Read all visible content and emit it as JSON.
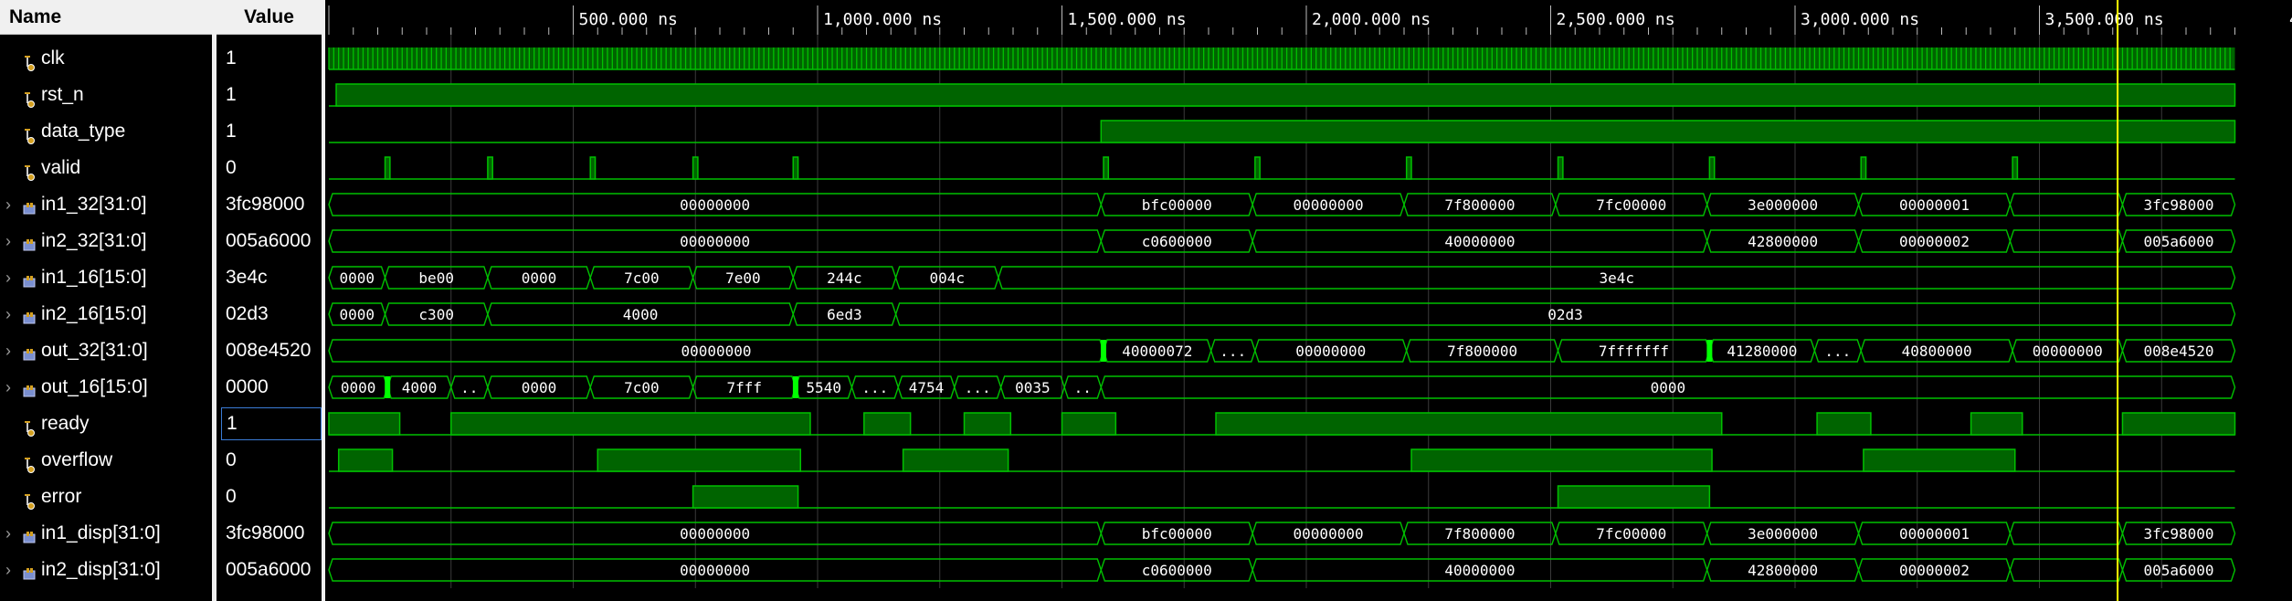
{
  "headers": {
    "name": "Name",
    "value": "Value"
  },
  "colors": {
    "wave": "#00c000",
    "fill": "#006400",
    "cursor": "#ffff00",
    "grid": "#3a3a3a"
  },
  "time_axis": {
    "unit": "ns",
    "range_ns": [
      0,
      3900
    ],
    "labels": [
      {
        "t": 500,
        "text": "500.000 ns"
      },
      {
        "t": 1000,
        "text": "1,000.000 ns"
      },
      {
        "t": 1500,
        "text": "1,500.000 ns"
      },
      {
        "t": 2000,
        "text": "2,000.000 ns"
      },
      {
        "t": 2500,
        "text": "2,500.000 ns"
      },
      {
        "t": 3000,
        "text": "3,000.000 ns"
      },
      {
        "t": 3500,
        "text": "3,500.000 ns"
      },
      {
        "t": 4000,
        "text": "4"
      }
    ]
  },
  "cursor_ns": 3660,
  "signals": [
    {
      "name": "clk",
      "value": "1",
      "kind": "clock",
      "expander": false,
      "icon": "wire-icon"
    },
    {
      "name": "rst_n",
      "value": "1",
      "kind": "bit",
      "expander": false,
      "icon": "wire-icon",
      "high": [
        [
          15,
          3900
        ]
      ]
    },
    {
      "name": "data_type",
      "value": "1",
      "kind": "bit",
      "expander": false,
      "icon": "wire-icon",
      "high": [
        [
          1580,
          3900
        ]
      ]
    },
    {
      "name": "valid",
      "value": "0",
      "kind": "bit",
      "expander": false,
      "icon": "wire-icon",
      "high": [
        [
          115,
          125
        ],
        [
          325,
          335
        ],
        [
          535,
          545
        ],
        [
          745,
          755
        ],
        [
          950,
          960
        ],
        [
          1585,
          1595
        ],
        [
          1895,
          1905
        ],
        [
          2205,
          2215
        ],
        [
          2515,
          2525
        ],
        [
          2825,
          2835
        ],
        [
          3135,
          3145
        ],
        [
          3445,
          3455
        ]
      ]
    },
    {
      "name": "in1_32[31:0]",
      "value": "3fc98000",
      "kind": "bus",
      "expander": true,
      "icon": "bus-icon",
      "segments": [
        [
          0,
          1580,
          "00000000"
        ],
        [
          1580,
          1890,
          "bfc00000"
        ],
        [
          1890,
          2200,
          "00000000"
        ],
        [
          2200,
          2510,
          "7f800000"
        ],
        [
          2510,
          2820,
          "7fc00000"
        ],
        [
          2820,
          3130,
          "3e000000"
        ],
        [
          3130,
          3440,
          "00000001"
        ],
        [
          3440,
          3670,
          ""
        ],
        [
          3670,
          3900,
          "3fc98000"
        ]
      ]
    },
    {
      "name": "in2_32[31:0]",
      "value": "005a6000",
      "kind": "bus",
      "expander": true,
      "icon": "bus-icon",
      "segments": [
        [
          0,
          1580,
          "00000000"
        ],
        [
          1580,
          1890,
          "c0600000"
        ],
        [
          1890,
          2820,
          "40000000"
        ],
        [
          2820,
          3130,
          "42800000"
        ],
        [
          3130,
          3440,
          "00000002"
        ],
        [
          3440,
          3670,
          ""
        ],
        [
          3670,
          3900,
          "005a6000"
        ]
      ]
    },
    {
      "name": "in1_16[15:0]",
      "value": "3e4c",
      "kind": "bus",
      "expander": true,
      "icon": "bus-icon",
      "segments": [
        [
          0,
          115,
          "0000"
        ],
        [
          115,
          325,
          "be00"
        ],
        [
          325,
          535,
          "0000"
        ],
        [
          535,
          745,
          "7c00"
        ],
        [
          745,
          950,
          "7e00"
        ],
        [
          950,
          1160,
          "244c"
        ],
        [
          1160,
          1370,
          "004c"
        ],
        [
          1370,
          3900,
          "3e4c"
        ]
      ]
    },
    {
      "name": "in2_16[15:0]",
      "value": "02d3",
      "kind": "bus",
      "expander": true,
      "icon": "bus-icon",
      "segments": [
        [
          0,
          115,
          "0000"
        ],
        [
          115,
          325,
          "c300"
        ],
        [
          325,
          950,
          "4000"
        ],
        [
          950,
          1160,
          "6ed3"
        ],
        [
          1160,
          3900,
          "02d3"
        ]
      ]
    },
    {
      "name": "out_32[31:0]",
      "value": "008e4520",
      "kind": "bus",
      "expander": true,
      "icon": "bus-icon",
      "segments": [
        [
          0,
          1585,
          "00000000"
        ],
        [
          1585,
          1805,
          "40000072"
        ],
        [
          1805,
          1895,
          "..."
        ],
        [
          1895,
          2205,
          "00000000"
        ],
        [
          2205,
          2515,
          "7f800000"
        ],
        [
          2515,
          2825,
          "7fffffff"
        ],
        [
          2825,
          3040,
          "41280000"
        ],
        [
          3040,
          3135,
          "..."
        ],
        [
          3135,
          3445,
          "40800000"
        ],
        [
          3445,
          3670,
          "00000000"
        ],
        [
          3670,
          3900,
          "008e4520"
        ]
      ],
      "glitches": [
        1585,
        2825
      ]
    },
    {
      "name": "out_16[15:0]",
      "value": "0000",
      "kind": "bus",
      "expander": true,
      "icon": "bus-icon",
      "segments": [
        [
          0,
          120,
          "0000"
        ],
        [
          120,
          250,
          "4000"
        ],
        [
          250,
          325,
          ".."
        ],
        [
          325,
          535,
          "0000"
        ],
        [
          535,
          745,
          "7c00"
        ],
        [
          745,
          955,
          "7fff"
        ],
        [
          955,
          1070,
          "5540"
        ],
        [
          1070,
          1165,
          "..."
        ],
        [
          1165,
          1280,
          "4754"
        ],
        [
          1280,
          1375,
          "..."
        ],
        [
          1375,
          1505,
          "0035"
        ],
        [
          1505,
          1580,
          ".."
        ],
        [
          1580,
          3900,
          "0000"
        ]
      ],
      "glitches": [
        120,
        955
      ]
    },
    {
      "name": "ready",
      "value": "1",
      "kind": "bit",
      "expander": false,
      "icon": "wire-icon",
      "selected": true,
      "high": [
        [
          0,
          145
        ],
        [
          250,
          985
        ],
        [
          1095,
          1190
        ],
        [
          1300,
          1395
        ],
        [
          1500,
          1610
        ],
        [
          1815,
          2850
        ],
        [
          3045,
          3155
        ],
        [
          3360,
          3465
        ],
        [
          3670,
          3900
        ]
      ]
    },
    {
      "name": "overflow",
      "value": "0",
      "kind": "bit",
      "expander": false,
      "icon": "wire-icon",
      "high": [
        [
          20,
          130
        ],
        [
          550,
          965
        ],
        [
          1175,
          1390
        ],
        [
          2215,
          2830
        ],
        [
          3140,
          3450
        ]
      ]
    },
    {
      "name": "error",
      "value": "0",
      "kind": "bit",
      "expander": false,
      "icon": "wire-icon",
      "high": [
        [
          745,
          960
        ],
        [
          2515,
          2825
        ]
      ]
    },
    {
      "name": "in1_disp[31:0]",
      "value": "3fc98000",
      "kind": "bus",
      "expander": true,
      "icon": "bus-icon",
      "segments": [
        [
          0,
          1580,
          "00000000"
        ],
        [
          1580,
          1890,
          "bfc00000"
        ],
        [
          1890,
          2200,
          "00000000"
        ],
        [
          2200,
          2510,
          "7f800000"
        ],
        [
          2510,
          2820,
          "7fc00000"
        ],
        [
          2820,
          3130,
          "3e000000"
        ],
        [
          3130,
          3440,
          "00000001"
        ],
        [
          3440,
          3670,
          ""
        ],
        [
          3670,
          3900,
          "3fc98000"
        ]
      ]
    },
    {
      "name": "in2_disp[31:0]",
      "value": "005a6000",
      "kind": "bus",
      "expander": true,
      "icon": "bus-icon",
      "segments": [
        [
          0,
          1580,
          "00000000"
        ],
        [
          1580,
          1890,
          "c0600000"
        ],
        [
          1890,
          2820,
          "40000000"
        ],
        [
          2820,
          3130,
          "42800000"
        ],
        [
          3130,
          3440,
          "00000002"
        ],
        [
          3440,
          3670,
          ""
        ],
        [
          3670,
          3900,
          "005a6000"
        ]
      ]
    }
  ]
}
